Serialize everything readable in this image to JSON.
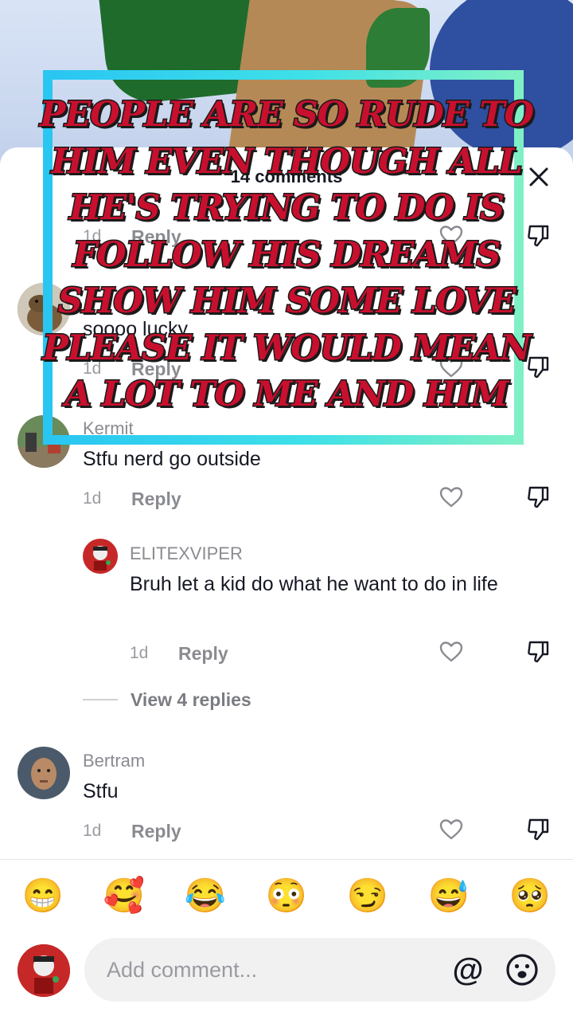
{
  "sheet": {
    "title": "14 comments",
    "close_icon": "close-icon"
  },
  "comments": [
    {
      "id": "partial-top",
      "username": "",
      "text": "",
      "time": "1d",
      "reply_label": "Reply"
    },
    {
      "id": "capybara",
      "username": "",
      "text": "soooo lucky",
      "time": "1d",
      "reply_label": "Reply"
    },
    {
      "id": "kermit",
      "username": "Kermit",
      "text": "Stfu nerd go outside",
      "time": "1d",
      "reply_label": "Reply"
    },
    {
      "id": "elitexviper",
      "username": "ELITEXVIPER",
      "text": "Bruh let a kid do what he want to do in life",
      "time": "1d",
      "reply_label": "Reply"
    },
    {
      "id": "bertram",
      "username": "Bertram",
      "text": "Stfu",
      "time": "1d",
      "reply_label": "Reply"
    }
  ],
  "view_replies_label": "View 4 replies",
  "emoji_bar": [
    "😁",
    "🥰",
    "😂",
    "😳",
    "😏",
    "😅",
    "🥺"
  ],
  "input": {
    "placeholder": "Add comment...",
    "mention_label": "@"
  },
  "overlay_caption": "People are so rude to him even though all he's trying to do is follow his dreams show him some love please it would mean a lot to me and him",
  "colors": {
    "caption_fill": "#c8102e",
    "frame_start": "#29c6f2",
    "frame_end": "#7ff0c6",
    "avatar_red": "#c62828"
  }
}
